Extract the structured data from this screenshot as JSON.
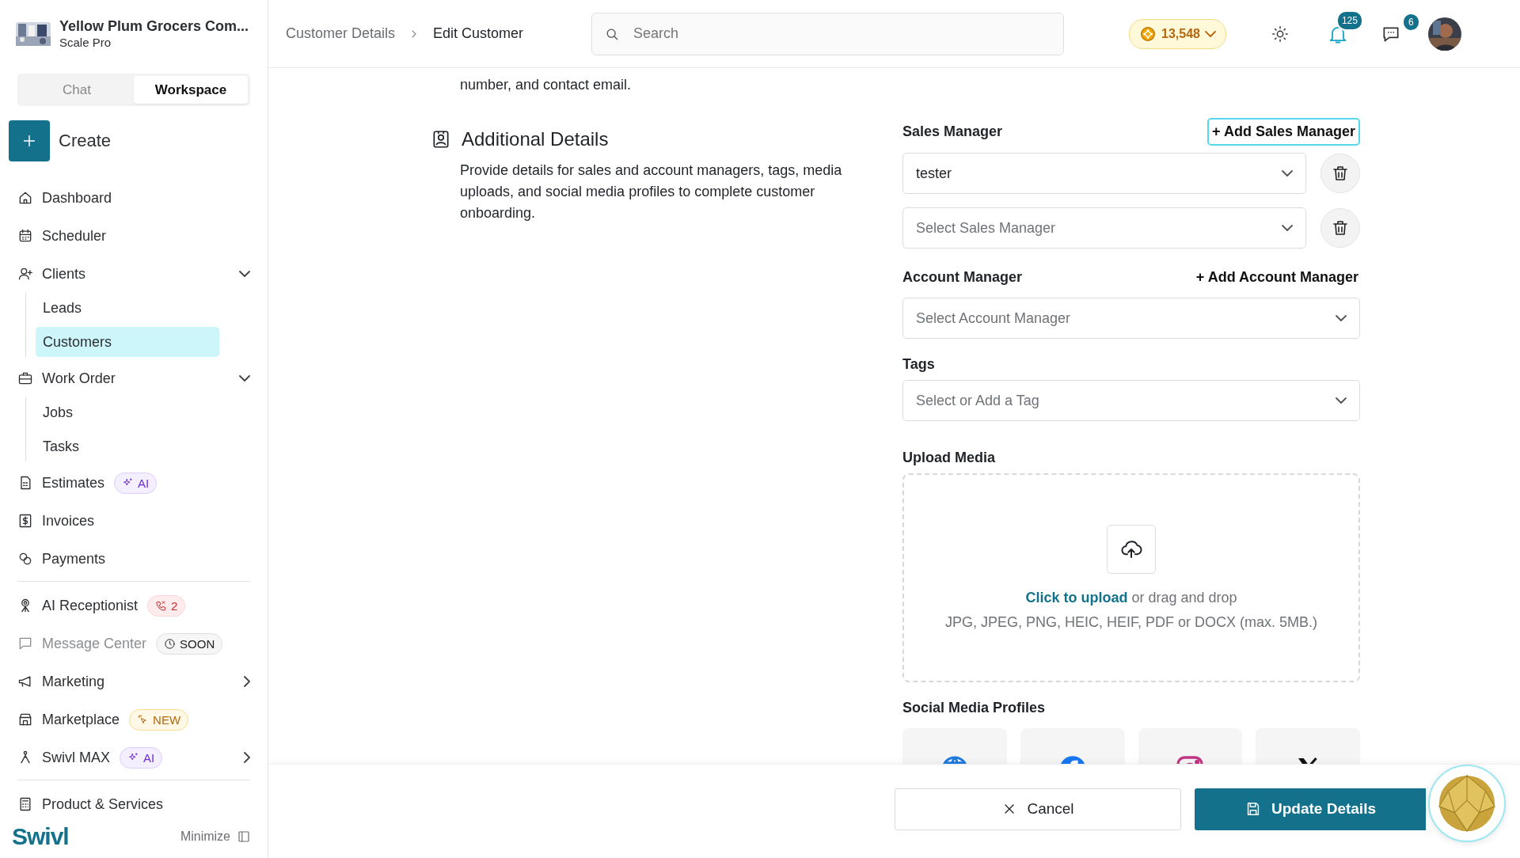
{
  "sidebar": {
    "company": {
      "name": "Yellow Plum Grocers Com...",
      "plan": "Scale Pro"
    },
    "tabs": [
      {
        "label": "Chat",
        "selected": false
      },
      {
        "label": "Workspace",
        "selected": true
      }
    ],
    "create_button": "Create",
    "nav_groups": [
      [
        {
          "label": "Dashboard",
          "selected": false
        },
        {
          "label": "Scheduler",
          "selected": false
        },
        {
          "label": "Clients",
          "selected": false,
          "expanded": true,
          "children": [
            {
              "label": "Leads",
              "selected": false
            },
            {
              "label": "Customers",
              "selected": true
            }
          ]
        },
        {
          "label": "Work Order",
          "selected": false,
          "expanded": true,
          "children": [
            {
              "label": "Jobs",
              "selected": false
            },
            {
              "label": "Tasks",
              "selected": false
            }
          ]
        },
        {
          "label": "Estimates",
          "selected": false,
          "badge": {
            "kind": "ai",
            "text": "AI"
          }
        },
        {
          "label": "Invoices",
          "selected": false
        },
        {
          "label": "Payments",
          "selected": false
        }
      ],
      [
        {
          "label": "AI Receptionist",
          "selected": false,
          "badge": {
            "kind": "missed_calls",
            "text": "2"
          }
        },
        {
          "label": "Message Center",
          "selected": false,
          "disabled": true,
          "badge": {
            "kind": "soon",
            "text": "SOON"
          }
        },
        {
          "label": "Marketing",
          "selected": false,
          "expanded": false
        },
        {
          "label": "Marketplace",
          "selected": false,
          "badge": {
            "kind": "new",
            "text": "NEW"
          }
        },
        {
          "label": "Swivl MAX",
          "selected": false,
          "expanded": false,
          "badge": {
            "kind": "ai",
            "text": "AI"
          }
        }
      ],
      [
        {
          "label": "Product & Services",
          "selected": false
        }
      ]
    ],
    "logo": "Swivl",
    "minimize": "Minimize"
  },
  "header": {
    "breadcrumbs": [
      "Customer Details",
      "Edit Customer"
    ],
    "search": {
      "placeholder": "Search"
    },
    "coins": "13,548",
    "notifications": "125",
    "messages": "6"
  },
  "form": {
    "intro_tail": "number, and contact email.",
    "section": {
      "title": "Additional Details",
      "description": "Provide details for sales and account managers, tags, media uploads, and social media profiles to complete customer onboarding."
    },
    "sales_manager": {
      "label": "Sales Manager",
      "add_button": "+ Add Sales Manager",
      "selects": [
        {
          "value": "tester"
        },
        {
          "placeholder": "Select Sales Manager"
        }
      ]
    },
    "account_manager": {
      "label": "Account Manager",
      "add_button": "+ Add Account Manager",
      "select": {
        "placeholder": "Select Account Manager"
      }
    },
    "tags": {
      "label": "Tags",
      "select": {
        "placeholder": "Select or Add a Tag"
      }
    },
    "upload": {
      "label": "Upload Media",
      "link": "Click to upload",
      "text": " or drag and drop",
      "hint": "JPG, JPEG, PNG, HEIC, HEIF, PDF or DOCX (max. 5MB.)"
    },
    "social": {
      "label": "Social Media Profiles",
      "profiles": [
        {
          "kind": "website"
        },
        {
          "kind": "facebook"
        },
        {
          "kind": "instagram"
        },
        {
          "kind": "x"
        }
      ]
    }
  },
  "footer": {
    "cancel": "Cancel",
    "submit": "Update Details"
  }
}
